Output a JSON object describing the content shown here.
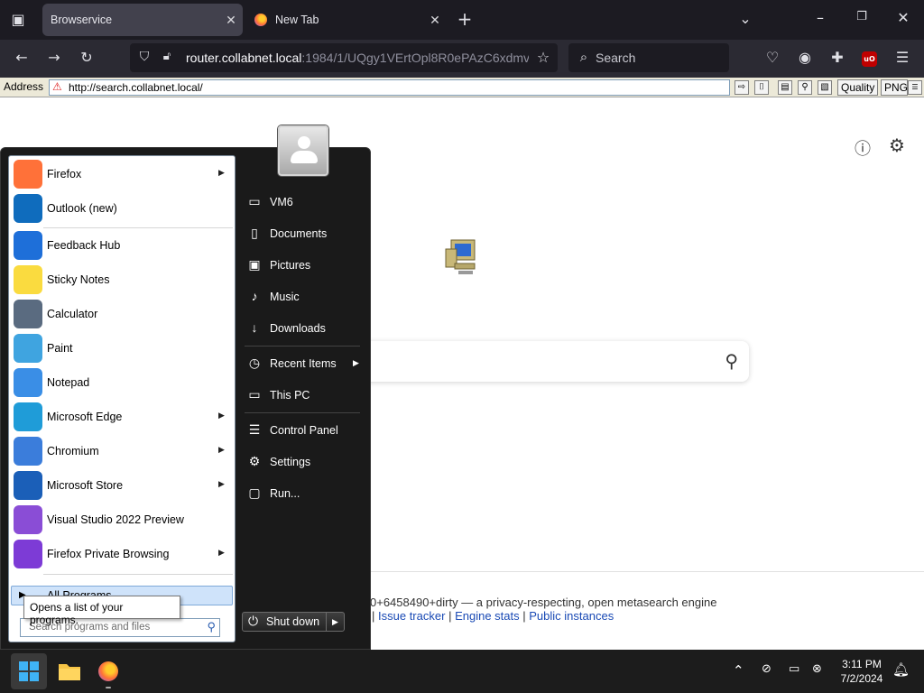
{
  "browser": {
    "tabs": [
      {
        "label": "Browservice",
        "active": true
      },
      {
        "label": "New Tab",
        "active": false
      }
    ],
    "new_tab_glyph": "+",
    "url": {
      "host": "router.collabnet.local",
      "rest": ":1984/1/UQgy1VErtOpl8R0ePAzC6xdmv"
    },
    "search_label": "Search",
    "icons": [
      "tab-list-icon",
      "close-icon",
      "new-tab-icon",
      "tab-overflow-icon",
      "minimize-icon",
      "restore-icon",
      "window-close-icon",
      "back-icon",
      "forward-icon",
      "reload-icon",
      "shield-icon",
      "lock-icon",
      "star-icon",
      "search-icon",
      "pocket-icon",
      "account-icon",
      "extensions-icon",
      "ublock-icon",
      "menu-icon"
    ]
  },
  "browservice_bar": {
    "address_label": "Address",
    "address_value": "http://search.collabnet.local/",
    "quality_label": "Quality",
    "format_value": "PNG"
  },
  "page": {
    "footer_version": "0+6458490+dirty — a privacy-respecting, open metasearch engine",
    "footer_links": [
      "Issue tracker",
      "Engine stats",
      "Public instances"
    ],
    "footer_sep": "|",
    "icons": [
      "info-icon",
      "settings-gear-icon",
      "computer-logo-icon",
      "search-icon"
    ]
  },
  "start_menu": {
    "programs": [
      {
        "label": "Firefox",
        "arrow": true,
        "icon": "firefox-icon",
        "color": "#ff7139"
      },
      {
        "label": "Outlook (new)",
        "arrow": false,
        "icon": "outlook-icon",
        "color": "#0f6cbd"
      },
      {
        "label": "Feedback Hub",
        "arrow": false,
        "icon": "feedback-hub-icon",
        "color": "#1e6fd9"
      },
      {
        "label": "Sticky Notes",
        "arrow": false,
        "icon": "sticky-notes-icon",
        "color": "#fadb3f"
      },
      {
        "label": "Calculator",
        "arrow": false,
        "icon": "calculator-icon",
        "color": "#5a6b80"
      },
      {
        "label": "Paint",
        "arrow": false,
        "icon": "paint-icon",
        "color": "#3fa4e0"
      },
      {
        "label": "Notepad",
        "arrow": false,
        "icon": "notepad-icon",
        "color": "#3a8ee6"
      },
      {
        "label": "Microsoft Edge",
        "arrow": true,
        "icon": "edge-icon",
        "color": "#1f9cd8"
      },
      {
        "label": "Chromium",
        "arrow": true,
        "icon": "chromium-icon",
        "color": "#3b7ddb"
      },
      {
        "label": "Microsoft Store",
        "arrow": true,
        "icon": "store-icon",
        "color": "#1b5fb8"
      },
      {
        "label": "Visual Studio 2022 Preview",
        "arrow": false,
        "icon": "visual-studio-icon",
        "color": "#8a4dd6"
      },
      {
        "label": "Firefox Private Browsing",
        "arrow": true,
        "icon": "firefox-private-icon",
        "color": "#7d3bd6"
      }
    ],
    "all_programs": "All Programs",
    "all_programs_tooltip": "Opens a list of your programs.",
    "search_placeholder": "Search programs and files",
    "places": [
      {
        "label": "VM6",
        "icon": "user-folder-icon",
        "glyph": "▭",
        "arrow": false
      },
      {
        "label": "Documents",
        "icon": "documents-icon",
        "glyph": "▯",
        "arrow": false
      },
      {
        "label": "Pictures",
        "icon": "pictures-icon",
        "glyph": "▣",
        "arrow": false
      },
      {
        "label": "Music",
        "icon": "music-icon",
        "glyph": "♪",
        "arrow": false
      },
      {
        "label": "Downloads",
        "icon": "downloads-icon",
        "glyph": "↓",
        "arrow": false
      },
      {
        "label": "Recent Items",
        "icon": "recent-items-icon",
        "glyph": "◷",
        "arrow": true
      },
      {
        "label": "This PC",
        "icon": "this-pc-icon",
        "glyph": "▭",
        "arrow": false
      },
      {
        "label": "Control Panel",
        "icon": "control-panel-icon",
        "glyph": "☰",
        "arrow": false
      },
      {
        "label": "Settings",
        "icon": "settings-icon",
        "glyph": "⚙",
        "arrow": false
      },
      {
        "label": "Run...",
        "icon": "run-icon",
        "glyph": "▢",
        "arrow": false
      }
    ],
    "shutdown_label": "Shut down"
  },
  "taskbar": {
    "time": "3:11 PM",
    "date": "7/2/2024",
    "pinned": [
      "start-button",
      "file-explorer-button",
      "firefox-button"
    ]
  }
}
